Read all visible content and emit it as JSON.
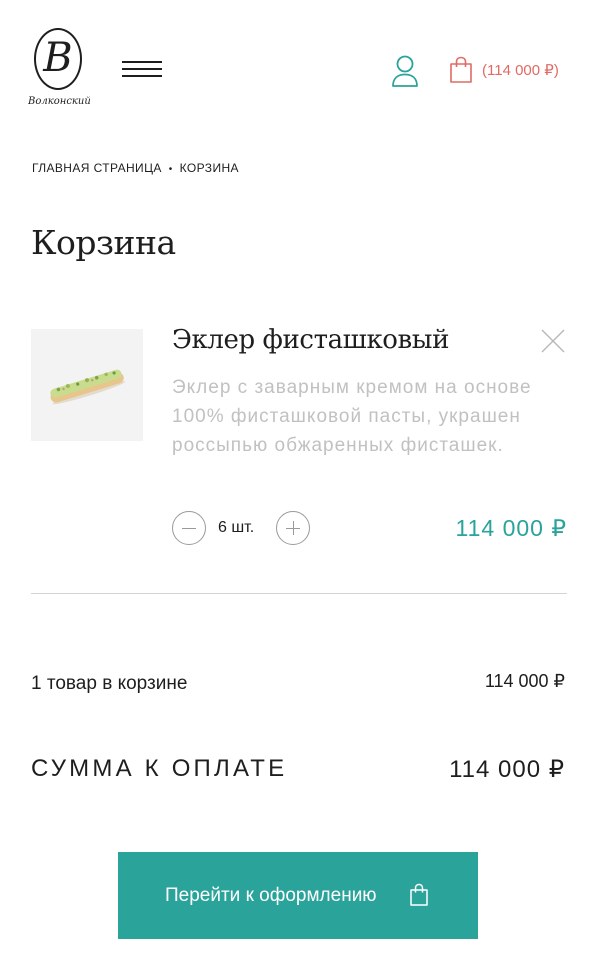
{
  "header": {
    "logo_monogram": "B",
    "logo_wordmark": "Волконский",
    "cart_total": "(114 000 ₽)"
  },
  "breadcrumb": {
    "home": "ГЛАВНАЯ СТРАНИЦА",
    "separator": "•",
    "current": "КОРЗИНА"
  },
  "page": {
    "title": "Корзина"
  },
  "cart": {
    "items": [
      {
        "name": "Эклер фисташковый",
        "description": "Эклер с заварным кремом на основе 100% фисташковой пасты, украшен россыпью обжаренных фисташек.",
        "quantity": "6 шт.",
        "price": "114 000 ₽",
        "image": "pistachio-eclair"
      }
    ]
  },
  "summary": {
    "count_label": "1 товар в корзине",
    "count_price": "114 000 ₽",
    "total_label": "СУММА К ОПЛАТЕ",
    "total_price": "114 000 ₽"
  },
  "checkout": {
    "label": "Перейти к оформлению"
  },
  "colors": {
    "accent": "#2aa39a",
    "cart_badge": "#e06b64",
    "muted_text": "#c1c1c1",
    "text": "#1e1e1e"
  },
  "icons": {
    "menu": "menu-icon",
    "user": "user-icon",
    "cart": "shopping-bag-icon",
    "remove": "close-icon",
    "minus": "minus-icon",
    "plus": "plus-icon"
  }
}
